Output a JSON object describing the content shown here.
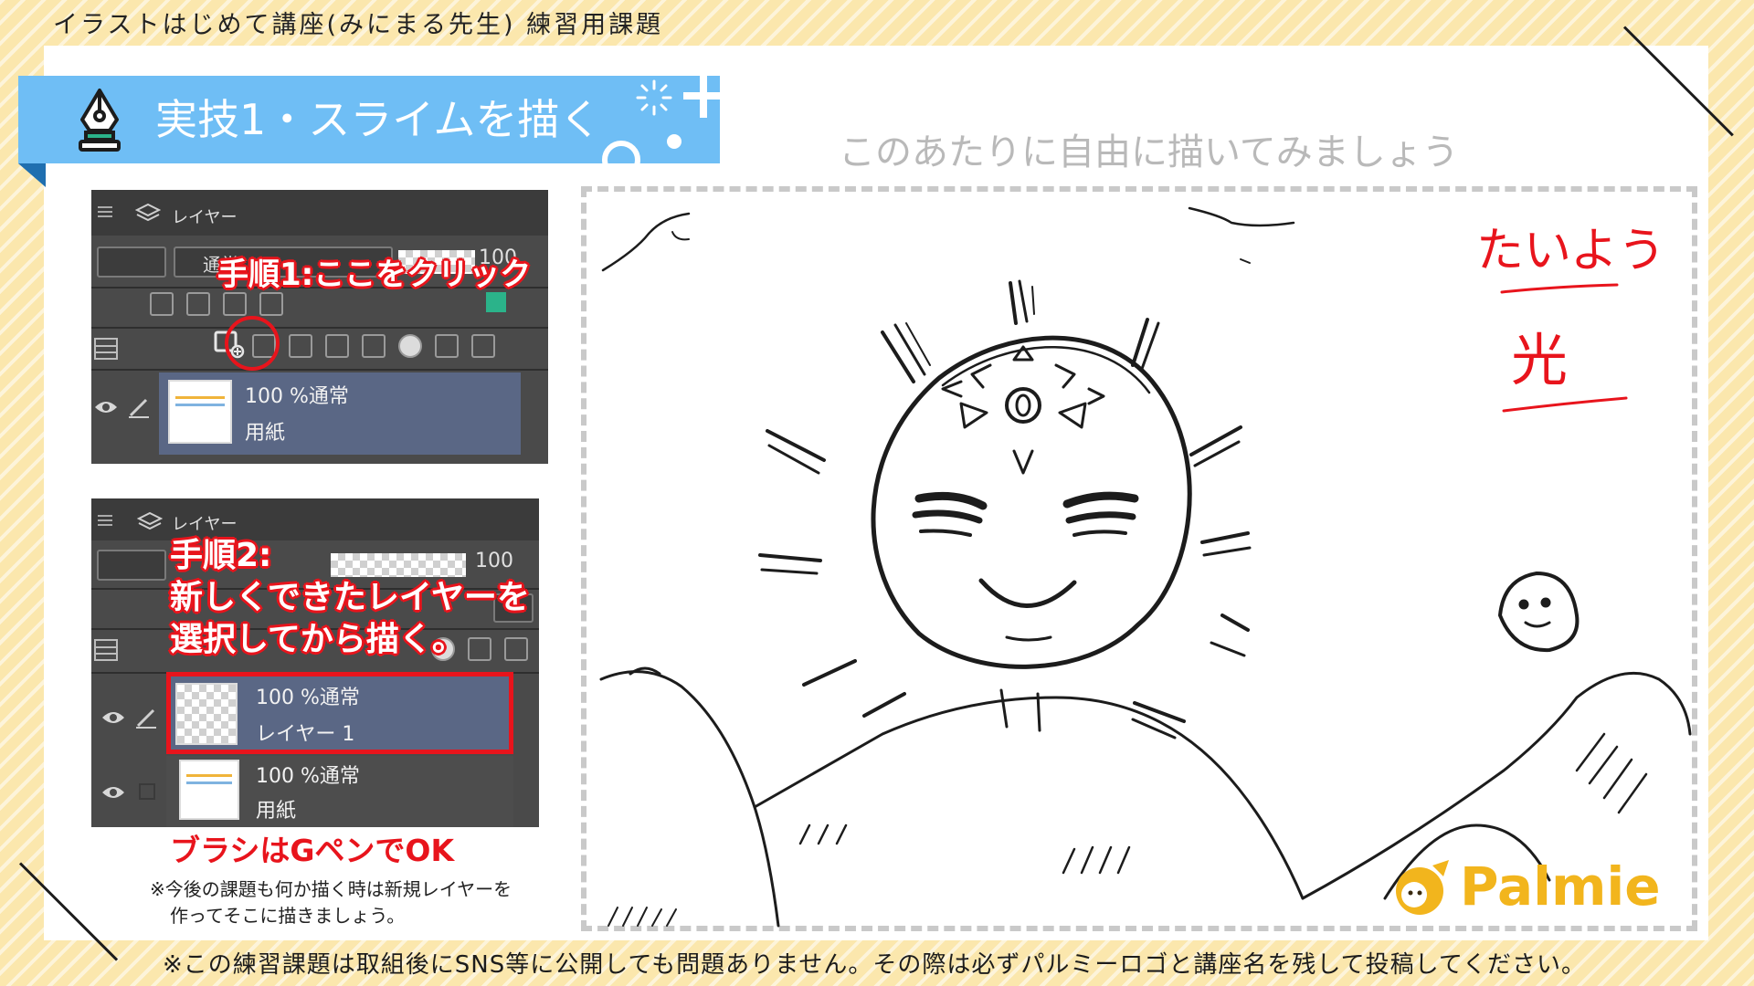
{
  "header": {
    "course_title": "イラストはじめて講座(みにまる先生) 練習用課題"
  },
  "banner": {
    "icon": "pen-nib-icon",
    "title": "実技1・スライムを描く",
    "color": "#6fbef5"
  },
  "step1_panel": {
    "tab_label": "レイヤー",
    "blend_mode": "通常",
    "opacity_value": "100",
    "callout": "手順1:ここをクリック",
    "layers": [
      {
        "opacity_mode": "100 %通常",
        "name": "用紙"
      }
    ]
  },
  "step2_panel": {
    "tab_label": "レイヤー",
    "opacity_value": "100",
    "callout_lines": [
      "手順2:",
      "新しくできたレイヤーを",
      "選択してから描く。"
    ],
    "layers": [
      {
        "opacity_mode": "100 %通常",
        "name": "レイヤー 1"
      },
      {
        "opacity_mode": "100 %通常",
        "name": "用紙"
      }
    ]
  },
  "instructions": {
    "brush_note": "ブラシはGペンでOK",
    "note_lines": [
      "※今後の課題も何か描く時は新規レイヤーを",
      "作ってそこに描きましょう。"
    ]
  },
  "canvas": {
    "hint": "このあたりに自由に描いてみましょう",
    "handwritten": [
      "たいよう",
      "光"
    ]
  },
  "logo": {
    "text": "Palmie",
    "color": "#f2b51d"
  },
  "footer": {
    "text": "※この練習課題は取組後にSNS等に公開しても問題ありません。その際は必ずパルミーロゴと講座名を残して投稿してください。"
  },
  "colors": {
    "accent_red": "#e8141c",
    "background": "#fbe7ad",
    "layer_selected": "#5a6785"
  }
}
